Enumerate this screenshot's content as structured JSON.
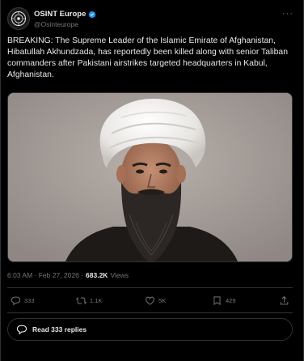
{
  "author": {
    "name": "OSINT Europe",
    "handle": "@Osinteurope",
    "verified": true
  },
  "post": {
    "text": "BREAKING: The Supreme Leader of the Islamic Emirate of Afghanistan, Hibatullah Akhundzada, has reportedly been killed along with senior Taliban commanders after Pakistani airstrikes targeted headquarters in Kabul, Afghanistan.",
    "timestamp": "6:03 AM · Feb 27, 2026 ·",
    "views_count": "683.2K",
    "views_label": "Views"
  },
  "actions": {
    "replies": "333",
    "reposts": "1.1K",
    "likes": "5K",
    "bookmarks": "429"
  },
  "read_replies_label": "Read 333 replies",
  "colors": {
    "background": "#000000",
    "text": "#e7e9ea",
    "muted": "#71767b",
    "verified": "#1d9bf0",
    "border": "#2f3336"
  },
  "icons": [
    "osint-logo-icon",
    "verified-badge-icon",
    "more-icon",
    "reply-icon",
    "repost-icon",
    "like-icon",
    "bookmark-icon",
    "share-icon",
    "read-replies-icon"
  ]
}
